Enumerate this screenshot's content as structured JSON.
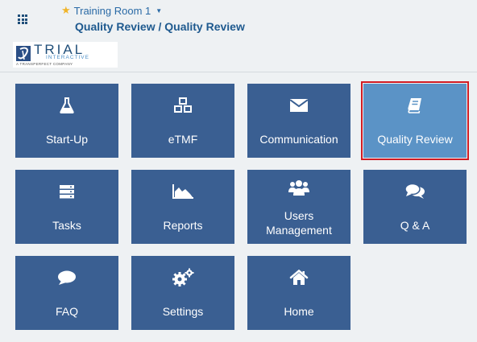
{
  "header": {
    "room_name": "Training Room 1",
    "page_title": "Quality Review / Quality Review"
  },
  "logo": {
    "word": "TRIAL",
    "sub": "INTERACTIVE",
    "tagline": "A TRANSPERFECT COMPANY"
  },
  "tiles": [
    {
      "label": "Start-Up",
      "icon": "flask-icon"
    },
    {
      "label": "eTMF",
      "icon": "cubes-icon"
    },
    {
      "label": "Communication",
      "icon": "envelope-icon"
    },
    {
      "label": "Quality Review",
      "icon": "book-icon",
      "active": true
    },
    {
      "label": "Tasks",
      "icon": "server-icon"
    },
    {
      "label": "Reports",
      "icon": "area-chart-icon"
    },
    {
      "label_line1": "Users",
      "label_line2": "Management",
      "icon": "users-icon"
    },
    {
      "label": "Q & A",
      "icon": "comments-icon"
    },
    {
      "label": "FAQ",
      "icon": "comment-icon"
    },
    {
      "label": "Settings",
      "icon": "gears-icon"
    },
    {
      "label": "Home",
      "icon": "home-icon"
    }
  ],
  "colors": {
    "tile": "#3a5f92",
    "tile_active": "#5b93c6",
    "highlight_border": "#d01c24",
    "title": "#1f5a8f",
    "star": "#f0b429"
  }
}
